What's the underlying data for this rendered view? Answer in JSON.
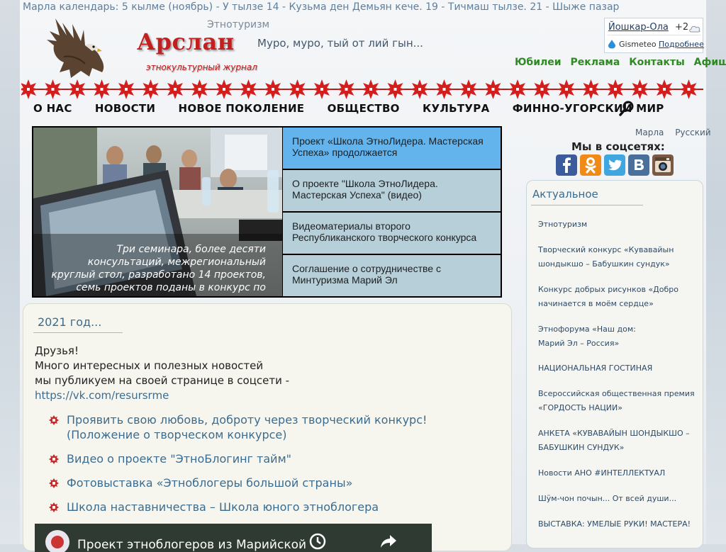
{
  "calendar": "Марла календарь: 5 кылме (ноябрь) - У тылзе 14 - Кузьма ден Демьян кече. 19 - Тичмаш тылзе. 21 - Шыже пазар",
  "logo": {
    "title": "Арслан",
    "subtitle": "этнокультурный журнал",
    "section": "Этнотуризм",
    "slogan": "Муро, муро, тый от лий гын..."
  },
  "weather": {
    "city": "Йошкар-Ола",
    "temp": "+2",
    "provider": "Gismeteo",
    "more": "Подробнее"
  },
  "toplinks": [
    "Юбилеи",
    "Реклама",
    "Контакты",
    "Афиша"
  ],
  "nav": [
    "О НАС",
    "НОВОСТИ",
    "НОВОЕ ПОКОЛЕНИЕ",
    "ОБЩЕСТВО",
    "КУЛЬТУРА",
    "ФИННО-УГОРСКИЙ МИР"
  ],
  "slider": {
    "caption": "Три семинара, более десяти консультаций, межрегиональный круглый стол, разработано 14 проектов, семь проектов поданы в конкурс по",
    "items": [
      "Проект «Школа ЭтноЛидера. Мастерская Успеха» продолжается",
      "О проекте \"Школа ЭтноЛидера. Мастерская Успеха\" (видео)",
      "Видеоматериалы второго Республиканского творческого конкурса",
      "Соглашение о сотрудничестве с Минтуризма Марий Эл"
    ]
  },
  "languages": [
    "Марла",
    "Русский"
  ],
  "social": {
    "title": "Мы в соцсетях:",
    "icons": [
      "facebook-icon",
      "odnoklassniki-icon",
      "twitter-icon",
      "vkontakte-icon",
      "instagram-icon"
    ]
  },
  "actual": {
    "title": "Актуальное",
    "items": [
      "Этнотуризм",
      "Творческий конкурс «Кувавайын шондыкшо – Бабушкин сундук»",
      "Конкурс добрых рисунков «Добро начинается в моём сердце»",
      "Этнофорума «Наш дом: Марий Эл – Россия»",
      "НАЦИОНАЛЬНАЯ ГОСТИНАЯ",
      "Всероссийская общественная премия «ГОРДОСТЬ НАЦИИ»",
      "АНКЕТА «КУВАВАЙЫН ШОНДЫКШО – БАБУШКИН СУНДУК»",
      "Новости АНО #ИНТЕЛЛЕКТУАЛ",
      "Шӱм-чон почын... От всей души...",
      "ВЫСТАВКА: УМЕЛЫЕ РУКИ! МАСТЕРА!"
    ]
  },
  "news": {
    "title": "2021 год...",
    "line1": "Друзья!",
    "line2": "Много интересных и полезных новостей",
    "line3": "мы публикуем на своей странице в соцсети -",
    "link": "https://vk.com/resursrme",
    "items": [
      "Проявить свою любовь, доброту через творческий конкурс!",
      "(Положение о творческом конкурсе)",
      "Видео о проекте \"ЭтноБлогинг тайм\"",
      "Фотовыставка «Этноблогеры большой страны»",
      "Школа наставничества – Школа юного этноблогера"
    ],
    "video_title": "Проект этноблогеров из Марийской"
  }
}
